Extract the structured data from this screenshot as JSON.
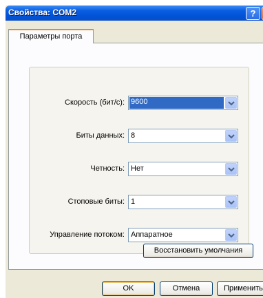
{
  "window": {
    "title": "Свойства: COM2",
    "help_glyph": "?",
    "close_glyph": "✕"
  },
  "tabs": [
    {
      "label": "Параметры порта",
      "active": true
    }
  ],
  "settings": [
    {
      "label": "Скорость (бит/с):",
      "value": "9600",
      "selected": true
    },
    {
      "label": "Биты данных:",
      "value": "8"
    },
    {
      "label": "Четность:",
      "value": "Нет"
    },
    {
      "label": "Стоповые биты:",
      "value": "1"
    },
    {
      "label": "Управление потоком:",
      "value": "Аппаратное"
    }
  ],
  "restore_defaults_label": "Восстановить умолчания",
  "dialog_buttons": {
    "ok": "OK",
    "cancel": "Отмена",
    "apply": "Применить"
  },
  "colors": {
    "titlebar": "#0052d6",
    "selection": "#316ac5",
    "tab_highlight": "#e68b2c",
    "dialog_bg": "#ece9d8"
  },
  "icons": {
    "combo_arrow": "chevron-down-icon"
  }
}
